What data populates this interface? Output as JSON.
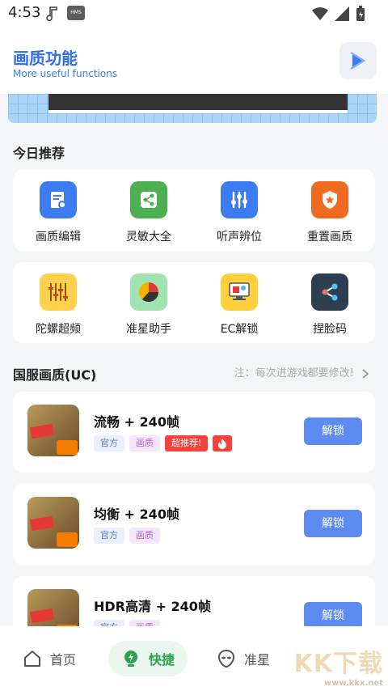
{
  "status": {
    "time": "4:53",
    "hms": "HMS"
  },
  "header": {
    "title": "画质功能",
    "subtitle": "More useful functions"
  },
  "today": {
    "title": "今日推荐",
    "row1": [
      {
        "label": "画质编辑",
        "icon": "edit-icon",
        "color": "#3d7cf0"
      },
      {
        "label": "灵敏大全",
        "icon": "share-icon",
        "color": "#4caf50"
      },
      {
        "label": "听声辨位",
        "icon": "equalizer-icon",
        "color": "#3d7cf0"
      },
      {
        "label": "重置画质",
        "icon": "shield-star-icon",
        "color": "#f06a1f"
      }
    ],
    "row2": [
      {
        "label": "陀螺超频",
        "icon": "sliders-icon",
        "color": "#ffd24d"
      },
      {
        "label": "准星助手",
        "icon": "pie-chart-icon",
        "color": "#9fe3b0"
      },
      {
        "label": "EC解锁",
        "icon": "monitor-icon",
        "color": "#ffcf3f"
      },
      {
        "label": "捏脸码",
        "icon": "share-node-icon",
        "color": "#2c3e50"
      }
    ]
  },
  "section2": {
    "title": "国服画质(UC)",
    "note": "注：每次进游戏都要修改!"
  },
  "items": [
    {
      "name": "流畅 + 240帧",
      "tag_official": "官方",
      "tag_pq": "画质",
      "tag_rec": "超推荐!",
      "button": "解锁"
    },
    {
      "name": "均衡 + 240帧",
      "tag_official": "官方",
      "tag_pq": "画质",
      "button": "解锁"
    },
    {
      "name": "HDR高清 + 240帧",
      "tag_official": "官方",
      "tag_pq": "画质",
      "button": "解锁"
    }
  ],
  "tabs": [
    {
      "label": "首页"
    },
    {
      "label": "快捷"
    },
    {
      "label": "准星"
    }
  ],
  "watermark": {
    "brand": "KK下载",
    "url": "www.kkx.net"
  },
  "colors": {
    "accent": "#2f6ee8",
    "active_tab": "#2aa14a",
    "unlock": "#5d8bf0"
  }
}
